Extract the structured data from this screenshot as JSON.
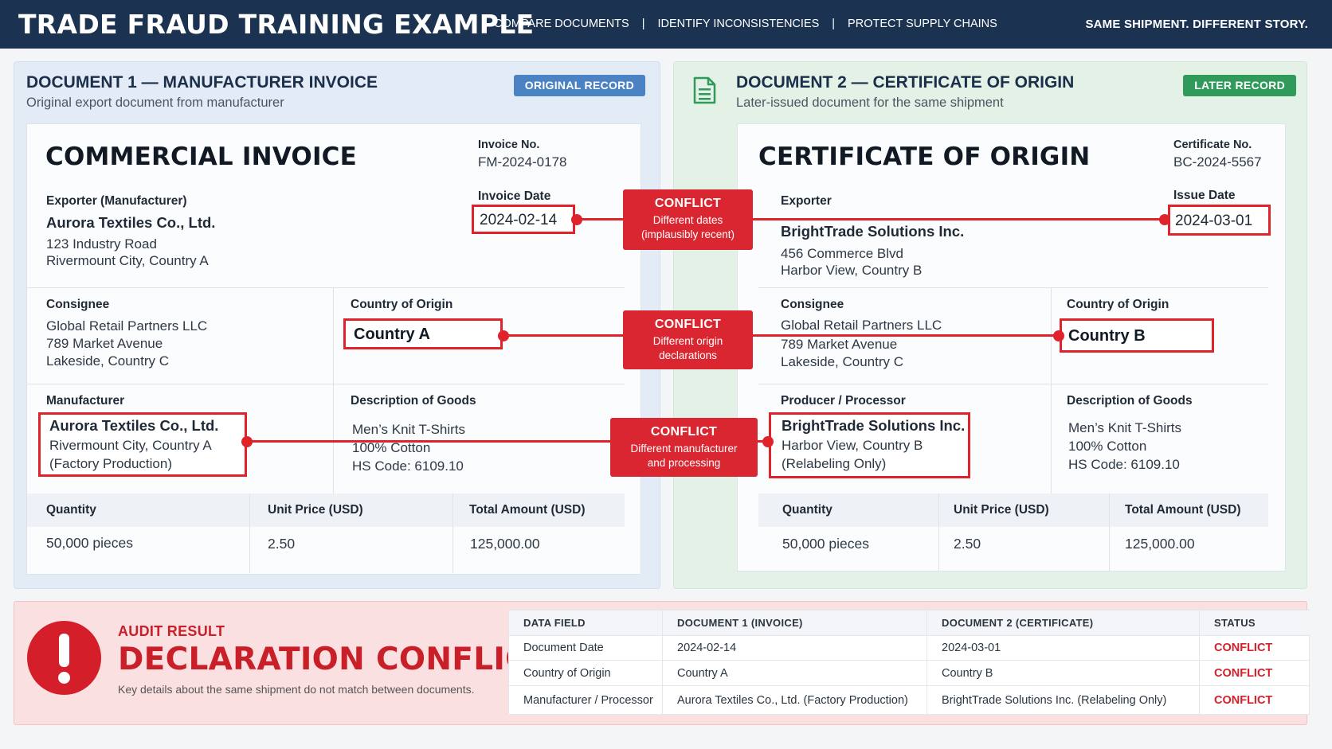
{
  "header": {
    "title": "TRADE FRAUD TRAINING EXAMPLE",
    "nav": [
      "COMPARE DOCUMENTS",
      "IDENTIFY INCONSISTENCIES",
      "PROTECT SUPPLY CHAINS"
    ],
    "separator": "|",
    "tagline": "SAME SHIPMENT. DIFFERENT STORY."
  },
  "doc1": {
    "panel_title": "DOCUMENT 1 — MANUFACTURER INVOICE",
    "panel_subtitle": "Original export document from manufacturer",
    "badge": "ORIGINAL RECORD",
    "title": "COMMERCIAL INVOICE",
    "number_label": "Invoice No.",
    "number": "FM-2024-0178",
    "date_label": "Invoice Date",
    "date": "2024-02-14",
    "exporter_label": "Exporter (Manufacturer)",
    "exporter_name": "Aurora Textiles Co., Ltd.",
    "exporter_addr1": "123 Industry Road",
    "exporter_addr2": "Rivermount City, Country A",
    "consignee_label": "Consignee",
    "consignee": [
      "Global Retail Partners LLC",
      "789 Market Avenue",
      "Lakeside, Country C"
    ],
    "origin_label": "Country of Origin",
    "origin": "Country A",
    "maker_label": "Manufacturer",
    "maker_name": "Aurora Textiles Co., Ltd.",
    "maker_lines": [
      "Rivermount City, Country A",
      "(Factory Production)"
    ],
    "goods_label": "Description of Goods",
    "goods": [
      "Men’s Knit T-Shirts",
      "100% Cotton",
      "HS Code: 6109.10"
    ],
    "qty_label": "Quantity",
    "price_label": "Unit Price (USD)",
    "total_label": "Total Amount (USD)",
    "qty": "50,000 pieces",
    "price": "2.50",
    "total": "125,000.00"
  },
  "doc2": {
    "panel_title": "DOCUMENT 2 — CERTIFICATE OF ORIGIN",
    "panel_subtitle": "Later-issued document for the same shipment",
    "badge": "LATER RECORD",
    "title": "CERTIFICATE OF ORIGIN",
    "number_label": "Certificate No.",
    "number": "BC-2024-5567",
    "date_label": "Issue Date",
    "date": "2024-03-01",
    "exporter_label": "Exporter",
    "exporter_name": "BrightTrade Solutions Inc.",
    "exporter_addr1": "456 Commerce Blvd",
    "exporter_addr2": "Harbor View, Country B",
    "consignee_label": "Consignee",
    "consignee": [
      "Global Retail Partners LLC",
      "789 Market Avenue",
      "Lakeside, Country C"
    ],
    "origin_label": "Country of Origin",
    "origin": "Country B",
    "maker_label": "Producer / Processor",
    "maker_name": "BrightTrade Solutions Inc.",
    "maker_lines": [
      "Harbor View, Country B",
      "(Relabeling Only)"
    ],
    "goods_label": "Description of Goods",
    "goods": [
      "Men’s Knit T-Shirts",
      "100% Cotton",
      "HS Code: 6109.10"
    ],
    "qty_label": "Quantity",
    "price_label": "Unit Price (USD)",
    "total_label": "Total Amount (USD)",
    "qty": "50,000 pieces",
    "price": "2.50",
    "total": "125,000.00"
  },
  "conflicts": [
    {
      "title": "CONFLICT",
      "lines": [
        "Different dates",
        "(implausibly recent)"
      ]
    },
    {
      "title": "CONFLICT",
      "lines": [
        "Different origin",
        "declarations"
      ]
    },
    {
      "title": "CONFLICT",
      "lines": [
        "Different manufacturer",
        "and processing"
      ]
    }
  ],
  "audit": {
    "kicker": "AUDIT RESULT",
    "headline": "DECLARATION CONFLICT",
    "note": "Key details about the same shipment do not match between documents.",
    "columns": [
      "DATA FIELD",
      "DOCUMENT 1 (INVOICE)",
      "DOCUMENT 2 (CERTIFICATE)",
      "STATUS"
    ],
    "rows": [
      [
        "Document Date",
        "2024-02-14",
        "2024-03-01",
        "CONFLICT"
      ],
      [
        "Country of Origin",
        "Country A",
        "Country B",
        "CONFLICT"
      ],
      [
        "Manufacturer / Processor",
        "Aurora Textiles Co., Ltd. (Factory Production)",
        "BrightTrade Solutions Inc. (Relabeling Only)",
        "CONFLICT"
      ]
    ]
  },
  "colors": {
    "header_bg": "#1b3350",
    "conflict_red": "#d92630",
    "badge_blue": "#4a82c4",
    "badge_green": "#2f9a5a"
  }
}
